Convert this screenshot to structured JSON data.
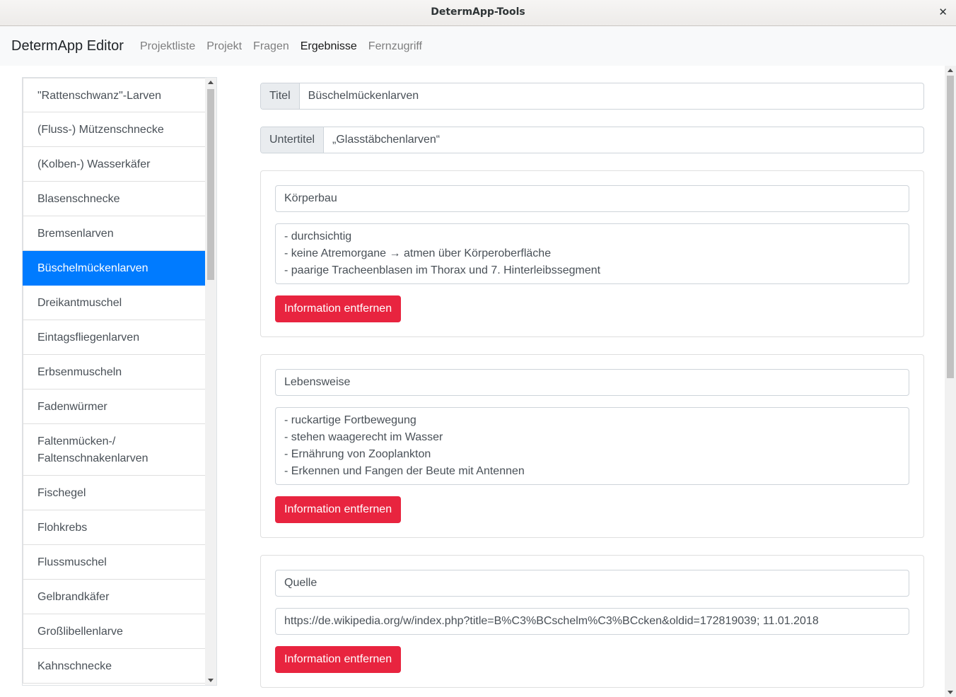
{
  "window": {
    "title": "DetermApp-Tools",
    "close_glyph": "✕"
  },
  "navbar": {
    "brand": "DetermApp Editor",
    "items": [
      {
        "label": "Projektliste",
        "active": false
      },
      {
        "label": "Projekt",
        "active": false
      },
      {
        "label": "Fragen",
        "active": false
      },
      {
        "label": "Ergebnisse",
        "active": true
      },
      {
        "label": "Fernzugriff",
        "active": false
      }
    ]
  },
  "sidebar": {
    "selected": "Büschelmückenlarven",
    "items": [
      {
        "label": "\"Rattenschwanz\"-Larven"
      },
      {
        "label": "(Fluss-) Mützenschnecke"
      },
      {
        "label": "(Kolben-) Wasserkäfer"
      },
      {
        "label": "Blasenschnecke"
      },
      {
        "label": "Bremsenlarven"
      },
      {
        "label": "Büschelmückenlarven"
      },
      {
        "label": "Dreikantmuschel"
      },
      {
        "label": "Eintagsfliegenlarven"
      },
      {
        "label": "Erbsenmuscheln"
      },
      {
        "label": "Fadenwürmer"
      },
      {
        "label": "Faltenmücken-/",
        "label2": "Faltenschnakenlarven"
      },
      {
        "label": "Fischegel"
      },
      {
        "label": "Flohkrebs"
      },
      {
        "label": "Flussmuschel"
      },
      {
        "label": "Gelbrandkäfer"
      },
      {
        "label": "Großlibellenlarve"
      },
      {
        "label": "Kahnschnecke"
      }
    ]
  },
  "form": {
    "title": {
      "label": "Titel",
      "value": "Büschelmückenlarven"
    },
    "subtitle": {
      "label": "Untertitel",
      "value": "„Glasstäbchenlarven“"
    },
    "remove_label": "Information entfernen",
    "infos": [
      {
        "heading": "Körperbau",
        "lines": [
          "- durchsichtig",
          "- keine Atremorgane → atmen über Körperoberfläche",
          "- paarige Tracheenblasen im Thorax und 7. Hinterleibssegment"
        ]
      },
      {
        "heading": "Lebensweise",
        "lines": [
          "- ruckartige Fortbewegung",
          "- stehen waagerecht im Wasser",
          "- Ernährung von Zooplankton",
          "- Erkennen und Fangen der Beute mit Antennen"
        ]
      },
      {
        "heading": "Quelle",
        "lines": [
          "https://de.wikipedia.org/w/index.php?title=B%C3%BCschelm%C3%BCcken&oldid=172819039; 11.01.2018"
        ]
      }
    ]
  },
  "colors": {
    "selected": "#007bff",
    "danger": "#e8243f",
    "navbar_bg": "#f8f9fa"
  }
}
